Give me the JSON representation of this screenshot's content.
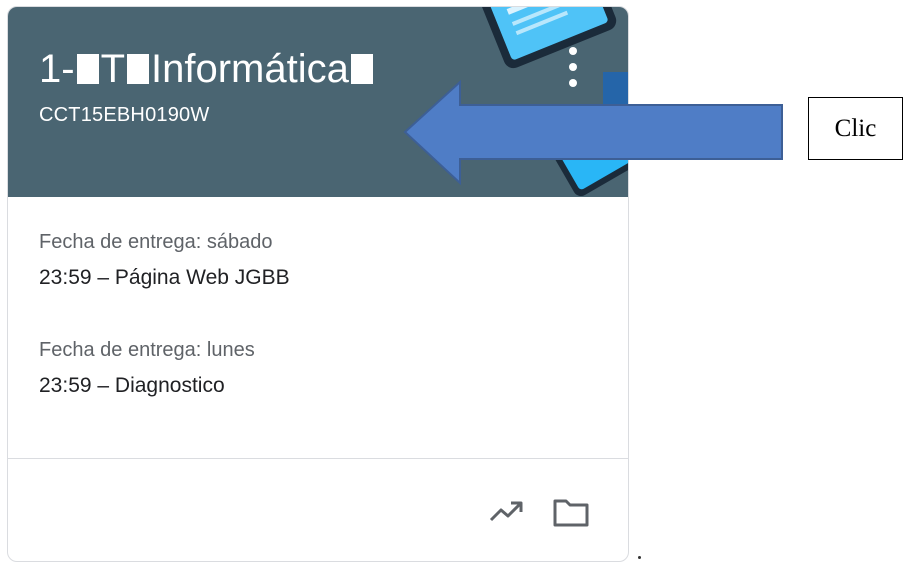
{
  "class_card": {
    "title_prefix": "1-",
    "title_mid": "T",
    "title_main": "Informática",
    "section_code": "CCT15EBH0190W",
    "header_color": "#4a6572",
    "assignments": [
      {
        "due": "Fecha de entrega: sábado",
        "task": "23:59 – Página Web JGBB"
      },
      {
        "due": "Fecha de entrega: lunes",
        "task": "23:59 – Diagnostico"
      }
    ],
    "actions": [
      {
        "icon": "trending-up-icon"
      },
      {
        "icon": "folder-icon"
      }
    ]
  },
  "annotation": {
    "callout_text": "Clic",
    "arrow_color": "#4f7dc6",
    "arrow_border": "#3d5f96"
  }
}
